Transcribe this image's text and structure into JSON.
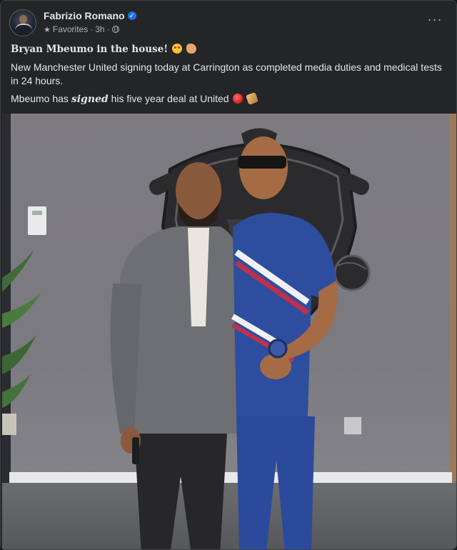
{
  "post": {
    "author": "Fabrizio Romano",
    "verified": true,
    "meta": {
      "feed": "Favorites",
      "time": "3h",
      "separator": "·",
      "audience_icon": "globe-icon",
      "favorite_icon": "star-icon"
    },
    "more_label": "···",
    "headline": "Bryan Mbeumo in the house!",
    "body_line": "New Manchester United signing today at Carrington as completed media duties and medical tests in 24 hours.",
    "signed_prefix": "Mbeumo has ",
    "signed_word": "signed",
    "signed_suffix": " his five year deal at United",
    "emojis": [
      "star-struck",
      "clapping-hands",
      "red-circle",
      "writing-hand"
    ],
    "photo_alt": "Two men posing in front of a Manchester United crest"
  },
  "colors": {
    "background": "#18191a",
    "card": "#242526",
    "text": "#e4e6eb",
    "secondary_text": "#b0b3b8",
    "verified": "#1b74e4"
  }
}
